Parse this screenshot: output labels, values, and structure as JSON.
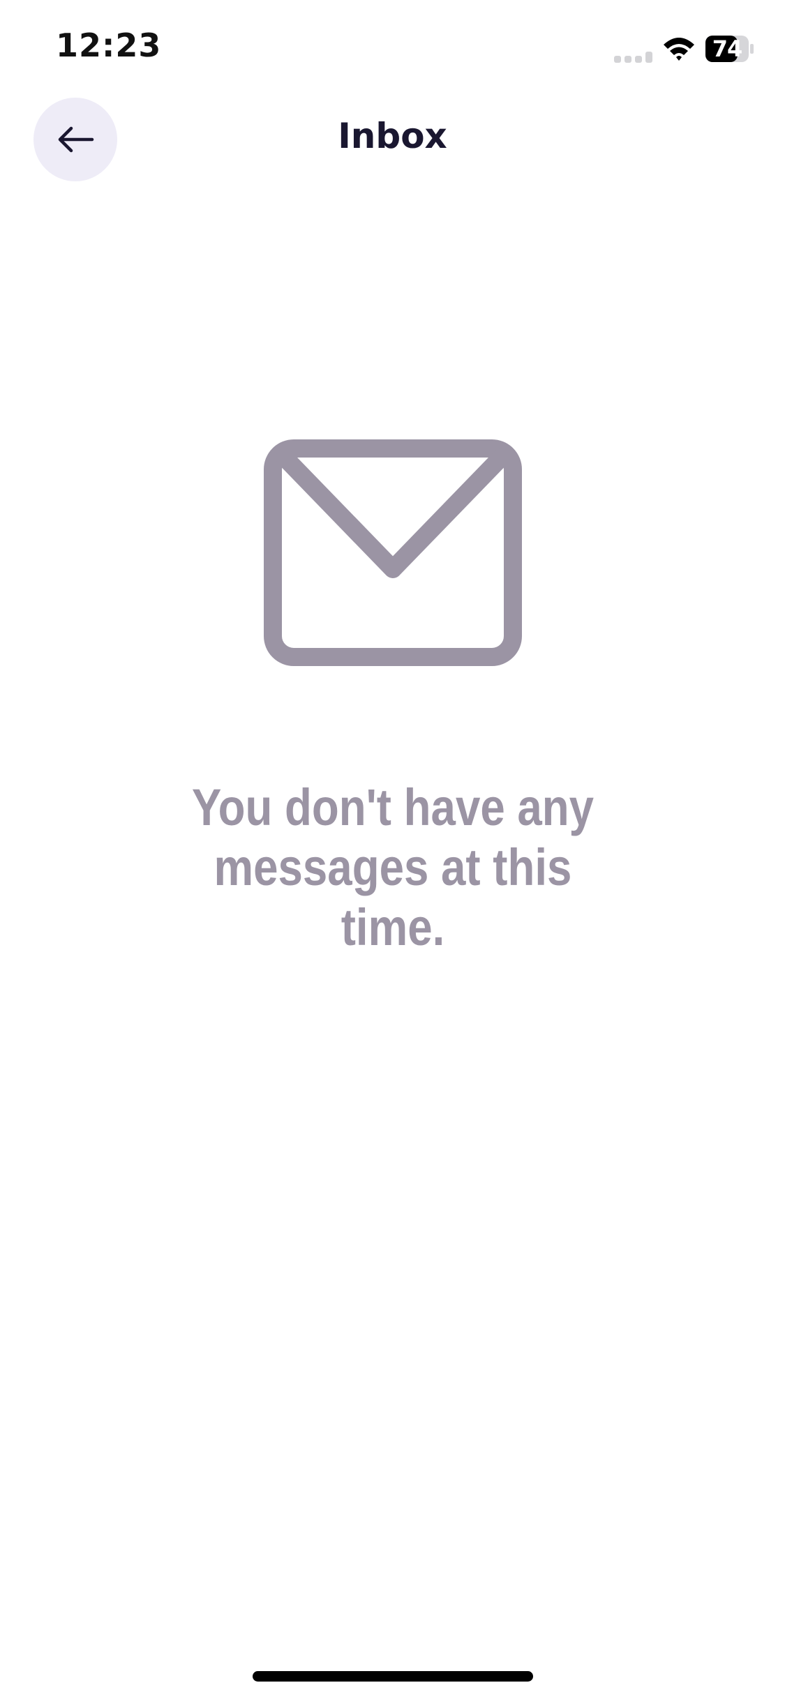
{
  "status_bar": {
    "time": "12:23",
    "battery_level": "74",
    "icons": [
      "signal-icon",
      "wifi-icon",
      "battery-icon"
    ]
  },
  "header": {
    "title": "Inbox",
    "back_icon": "arrow-left-icon"
  },
  "empty_state": {
    "icon": "mail-icon",
    "message": "You don't have any messages at this time."
  },
  "colors": {
    "title_text": "#1a1730",
    "back_button_bg": "#eeecf7",
    "empty_state_gray": "#9b94a4",
    "background": "#ffffff"
  }
}
